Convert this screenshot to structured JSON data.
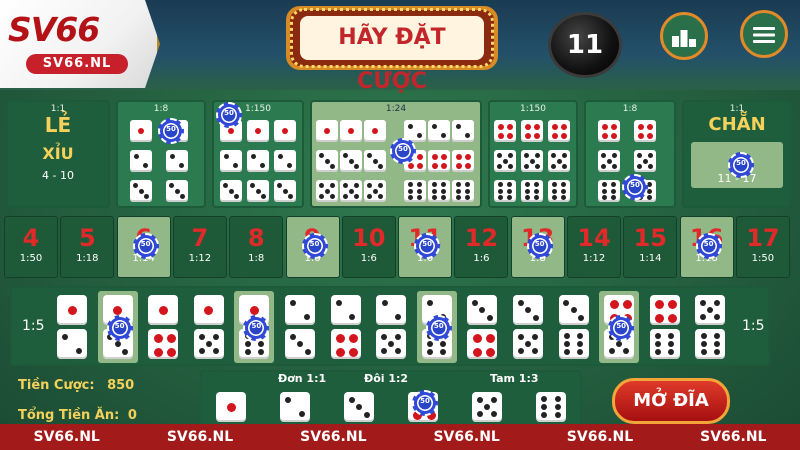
{
  "header": {
    "logo_text": "SV66",
    "logo_sub": "SV66.NL",
    "banner": "HÃY ĐẶT CƯỢC",
    "timer": "11",
    "stats_icon": "podium-icon",
    "menu_icon": "hamburger-menu-icon"
  },
  "top_bets": {
    "le": {
      "ratio": "1:1",
      "title": "LẺ",
      "subtitle": "XỈU",
      "range": "4 - 10"
    },
    "chan": {
      "ratio": "1:1",
      "title": "CHẴN",
      "range": "11 - 17"
    },
    "double_left": {
      "ratio": "1:8"
    },
    "triple_left": {
      "ratio": "1:150"
    },
    "any_triple": {
      "ratio": "1:24"
    },
    "triple_right": {
      "ratio": "1:150"
    },
    "double_right": {
      "ratio": "1:8"
    }
  },
  "sums": [
    {
      "n": "4",
      "r": "1:50"
    },
    {
      "n": "5",
      "r": "1:18"
    },
    {
      "n": "6",
      "r": "1:14"
    },
    {
      "n": "7",
      "r": "1:12"
    },
    {
      "n": "8",
      "r": "1:8"
    },
    {
      "n": "9",
      "r": "1:6"
    },
    {
      "n": "10",
      "r": "1:6"
    },
    {
      "n": "11",
      "r": "1:6"
    },
    {
      "n": "12",
      "r": "1:6"
    },
    {
      "n": "13",
      "r": "1:8"
    },
    {
      "n": "14",
      "r": "1:12"
    },
    {
      "n": "15",
      "r": "1:14"
    },
    {
      "n": "16",
      "r": "1:18"
    },
    {
      "n": "17",
      "r": "1:50"
    }
  ],
  "combos": {
    "left_ratio": "1:5",
    "right_ratio": "1:5"
  },
  "footer": {
    "tien_cuoc_label": "Tiền Cược:",
    "tien_cuoc_value": "850",
    "tong_tien_an_label": "Tổng Tiền Ăn:",
    "tong_tien_an_value": "0",
    "don": "Đơn 1:1",
    "doi": "Đôi 1:2",
    "tam": "Tam 1:3",
    "mo_dia": "MỞ ĐĨA"
  },
  "chip_value": "50",
  "watermarks": [
    "SV66.NL",
    "SV66.NL",
    "SV66.NL",
    "SV66.NL",
    "SV66.NL",
    "SV66.NL"
  ],
  "colors": {
    "accent": "#c2262b",
    "felt": "#2c7a4f",
    "gold": "#f4d15a",
    "bar": "#a31a1a"
  }
}
